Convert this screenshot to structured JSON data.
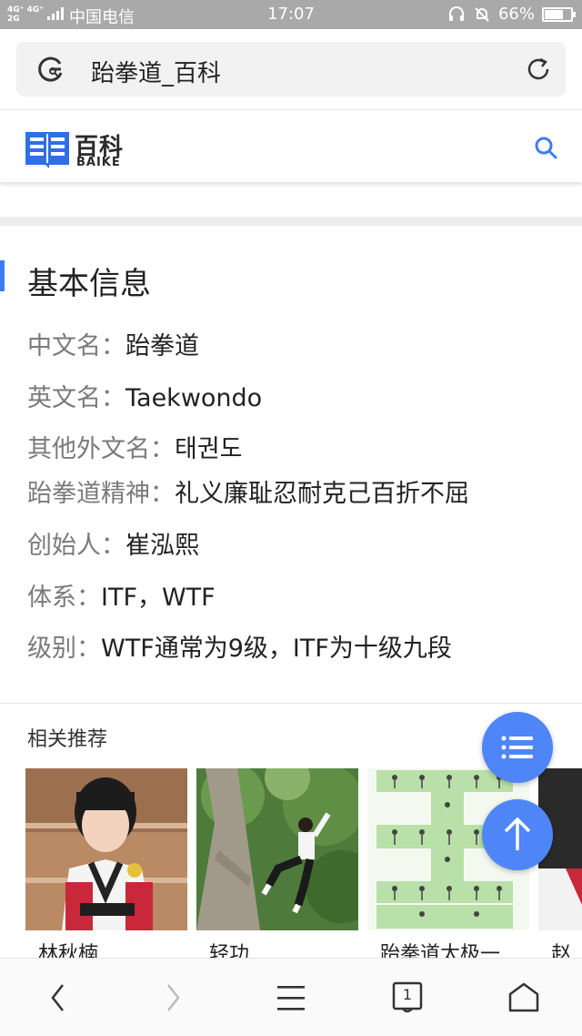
{
  "status_bar": {
    "network_top": "4G⁺ 4G⁺",
    "network_bottom": "2G",
    "carrier": "中国电信",
    "time": "17:07",
    "battery": "66%"
  },
  "address_bar": {
    "url_text": "跆拳道_百科"
  },
  "baike": {
    "logo_cn": "百科",
    "logo_en": "BAIKE"
  },
  "basic_info": {
    "title": "基本信息",
    "rows": [
      {
        "key": "中文名：",
        "value": "跆拳道"
      },
      {
        "key": "英文名：",
        "value": "Taekwondo"
      },
      {
        "key": "其他外文名：",
        "value": "태권도"
      },
      {
        "key": "跆拳道精神：",
        "value": "礼义廉耻忍耐克己百折不屈"
      },
      {
        "key": "创始人：",
        "value": "崔泓熙"
      },
      {
        "key": "体系：",
        "value": "ITF，WTF"
      },
      {
        "key": "级别：",
        "value": "WTF通常为9级，ITF为十级九段"
      }
    ]
  },
  "related": {
    "title": "相关推荐",
    "cards": [
      {
        "caption": "林秋楠"
      },
      {
        "caption": "轻功"
      },
      {
        "caption": "跆拳道太极一"
      },
      {
        "caption": "赵"
      }
    ]
  },
  "bottom_nav": {
    "tabs_count": "1"
  },
  "colors": {
    "accent": "#3b7cf5",
    "fab": "#4f86f7"
  }
}
